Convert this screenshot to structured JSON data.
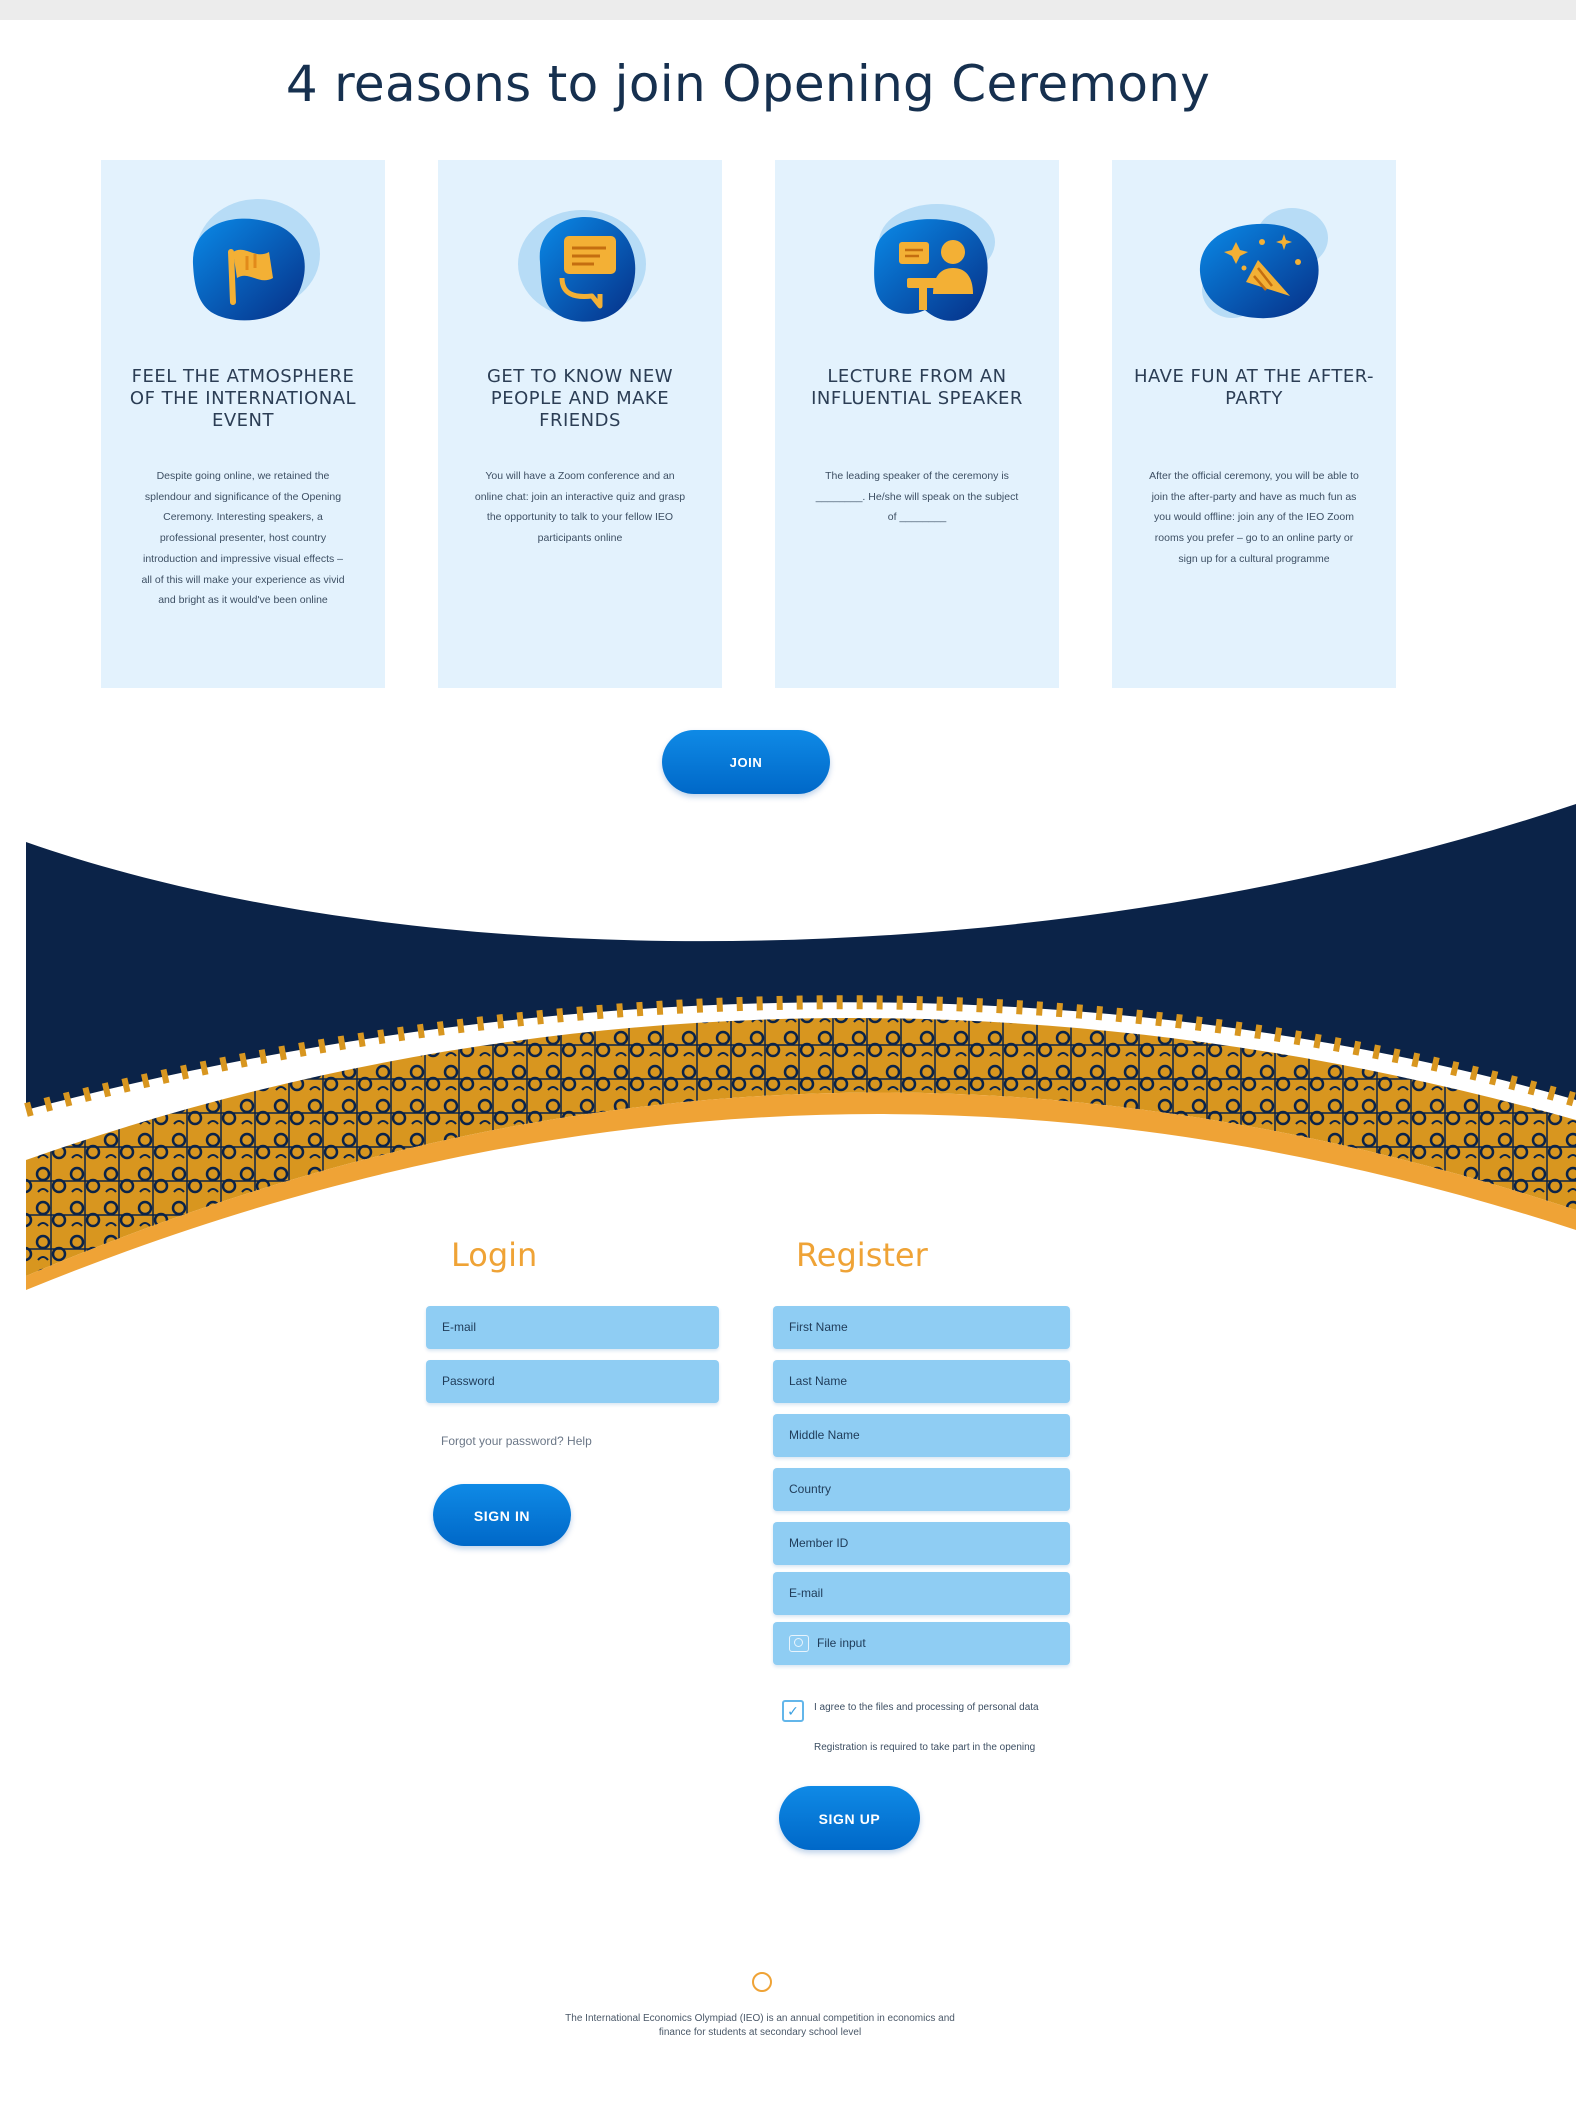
{
  "page": {
    "title": "4 reasons to join Opening Ceremony"
  },
  "colors": {
    "card_background": "#e3f2fd",
    "button_blue": "#0a7ad8",
    "navy_band": "#0b2348",
    "accent_orange": "#efa336",
    "field_blue": "#8fcdf3"
  },
  "cards": [
    {
      "icon": "flag-icon",
      "heading": "FEEL THE ATMOSPHERE OF THE INTERNATIONAL EVENT",
      "description": "Despite going online, we retained the splendour and significance of the Opening Ceremony. Interesting speakers, a professional presenter, host country introduction and impressive visual effects – all of this will make your experience as vivid and bright as it would've been online"
    },
    {
      "icon": "chat-icon",
      "heading": "GET TO KNOW NEW PEOPLE AND MAKE FRIENDS",
      "description": "You will have a Zoom conference and an online chat: join an interactive quiz and grasp the opportunity to talk to your fellow IEO participants online"
    },
    {
      "icon": "speaker-icon",
      "heading": "LECTURE FROM AN INFLUENTIAL SPEAKER",
      "description": "The leading speaker of the ceremony is ________. He/she will speak on the subject of ________"
    },
    {
      "icon": "party-popper-icon",
      "heading": "HAVE FUN AT THE AFTER-PARTY",
      "description": "After the official ceremony, you will be able to join the after-party and have as much fun as you would offline: join any of the IEO Zoom rooms you prefer – go to an online party or sign up for a cultural programme"
    }
  ],
  "join_button": "JOIN",
  "login": {
    "title": "Login",
    "email_placeholder": "E-mail",
    "password_placeholder": "Password",
    "forgot_text": "Forgot your password? Help",
    "signin_button": "SIGN IN"
  },
  "register": {
    "title": "Register",
    "fields": [
      "First Name",
      "Last Name",
      "Middle Name",
      "Country",
      "Member ID",
      "E-mail"
    ],
    "file_input": "File input",
    "agree_text": "I agree to the files and processing of personal data",
    "note_text": "Registration is required to take part in the opening",
    "signup_button": "SIGN UP"
  },
  "footer": {
    "text": "The International Economics Olympiad (IEO) is an annual competition in economics and finance for students at secondary school level"
  }
}
